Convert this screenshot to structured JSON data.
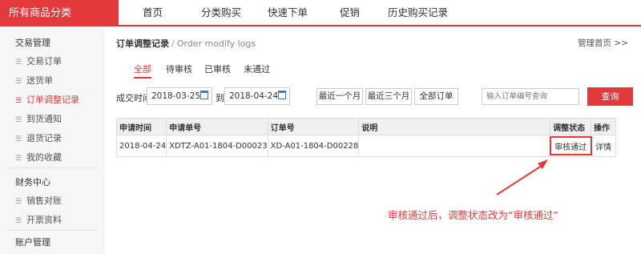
{
  "topnav": {
    "category": "所有商品分类",
    "items": [
      "首页",
      "分类购买",
      "快速下单",
      "促销",
      "历史购买记录"
    ]
  },
  "sidebar": {
    "groups": [
      {
        "title": "交易管理",
        "items": [
          "交易订单",
          "送货单",
          "订单调整记录",
          "到货通知",
          "退货记录",
          "我的收藏"
        ]
      },
      {
        "title": "财务中心",
        "items": [
          "销售对账",
          "开票资料"
        ]
      },
      {
        "title": "账户管理",
        "items": []
      }
    ],
    "active_item": "订单调整记录"
  },
  "breadcrumb": {
    "title": "订单调整记录",
    "separator": "/",
    "subtitle": "Order modify logs",
    "home_link": "管理首页 >>"
  },
  "tabs": [
    "全部",
    "待审核",
    "已审核",
    "未通过"
  ],
  "filter": {
    "label": "成交时间",
    "start_date": "2018-03-25",
    "to_label": "到",
    "end_date": "2018-04-24",
    "quick_buttons": [
      "最近一个月",
      "最近三个月",
      "全部订单"
    ],
    "search_placeholder": "输入订单编号查询",
    "search_button": "查询"
  },
  "table": {
    "headers": [
      "申请时间",
      "申请单号",
      "订单号",
      "说明",
      "调整状态",
      "操作"
    ],
    "rows": [
      {
        "apply_time": "2018-04-24",
        "apply_no": "XDTZ-A01-1804-D00023",
        "order_no": "XD-A01-1804-D00228",
        "note": "",
        "status": "审核通过",
        "action": "详情"
      }
    ]
  },
  "annotation": {
    "text": "审核通过后，调整状态改为“审核通过”",
    "color": "#e4393c"
  },
  "colors": {
    "accent": "#e4393c",
    "calendar": "#3b7bd8"
  }
}
